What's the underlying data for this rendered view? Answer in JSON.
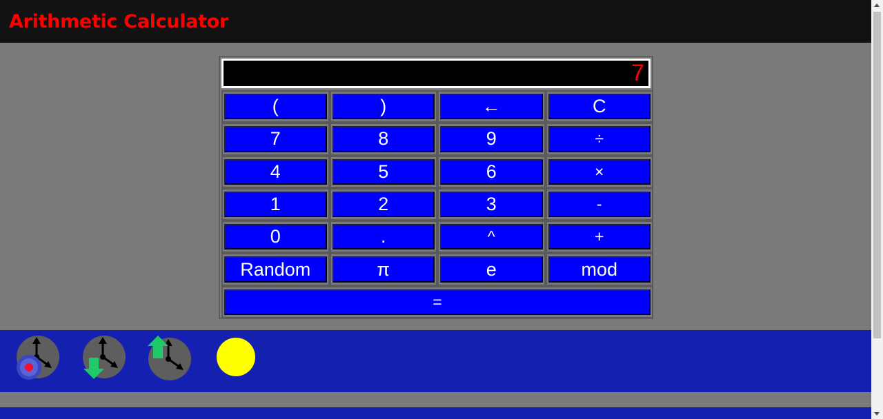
{
  "header": {
    "title": "Arithmetic Calculator"
  },
  "display": {
    "value": "7"
  },
  "keys": {
    "row1": [
      "(",
      ")",
      "←",
      "C"
    ],
    "row2": [
      "7",
      "8",
      "9",
      "÷"
    ],
    "row3": [
      "4",
      "5",
      "6",
      "×"
    ],
    "row4": [
      "1",
      "2",
      "3",
      "-"
    ],
    "row5": [
      "0",
      ".",
      "^",
      "+"
    ],
    "row6": [
      "Random",
      "π",
      "e",
      "mod"
    ],
    "row7": [
      "="
    ]
  },
  "toolbar": {
    "icons": [
      "clock-record-icon",
      "clock-download-icon",
      "clock-upload-icon",
      "yellow-circle-icon"
    ]
  },
  "colors": {
    "header_bg": "#121212",
    "title": "#ff0000",
    "button": "#0000ff",
    "toolbar_bg": "#1320b0",
    "page_bg": "#7a7a7a"
  }
}
